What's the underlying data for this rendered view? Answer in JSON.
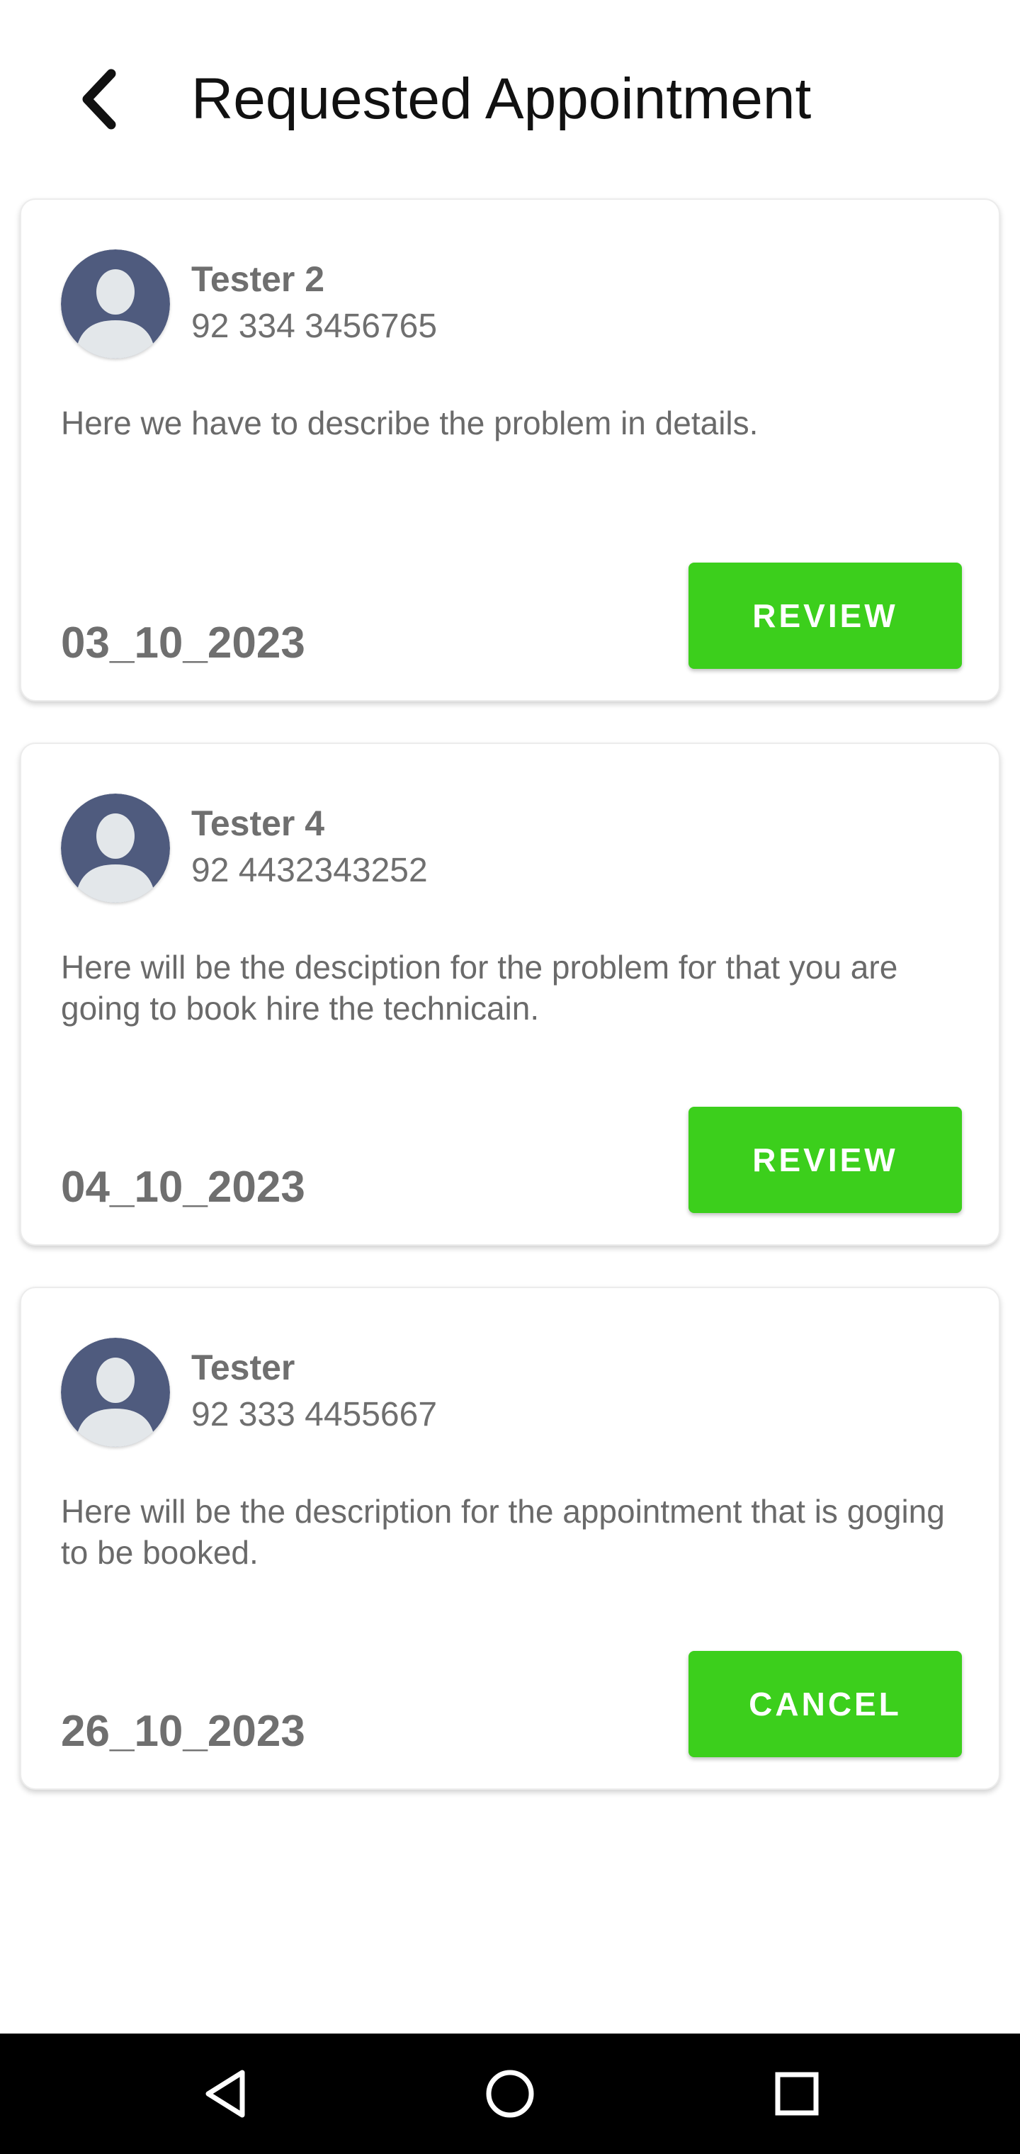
{
  "header": {
    "title": "Requested Appointment",
    "back_icon": "chevron-left-icon"
  },
  "appointments": [
    {
      "name": "Tester 2",
      "phone": "92 334 3456765",
      "description": "Here we have to describe the problem in details.",
      "date": "03_10_2023",
      "action_label": "REVIEW"
    },
    {
      "name": "Tester 4",
      "phone": "92 4432343252",
      "description": "Here will be the desciption for the problem for that you are going to book hire the technicain.",
      "date": "04_10_2023",
      "action_label": "REVIEW"
    },
    {
      "name": "Tester",
      "phone": "92 333 4455667",
      "description": "Here will be the description for the appointment that is goging to be booked.",
      "date": "26_10_2023",
      "action_label": "CANCEL"
    }
  ],
  "colors": {
    "accent": "#3ccf1c",
    "avatar_bg": "#4f5b7e",
    "avatar_fg": "#e3e7ea",
    "text_muted": "#6f6f6f",
    "navbar_bg": "#000000"
  },
  "navbar": {
    "icons": [
      "back-triangle-icon",
      "home-circle-icon",
      "recents-square-icon"
    ]
  }
}
